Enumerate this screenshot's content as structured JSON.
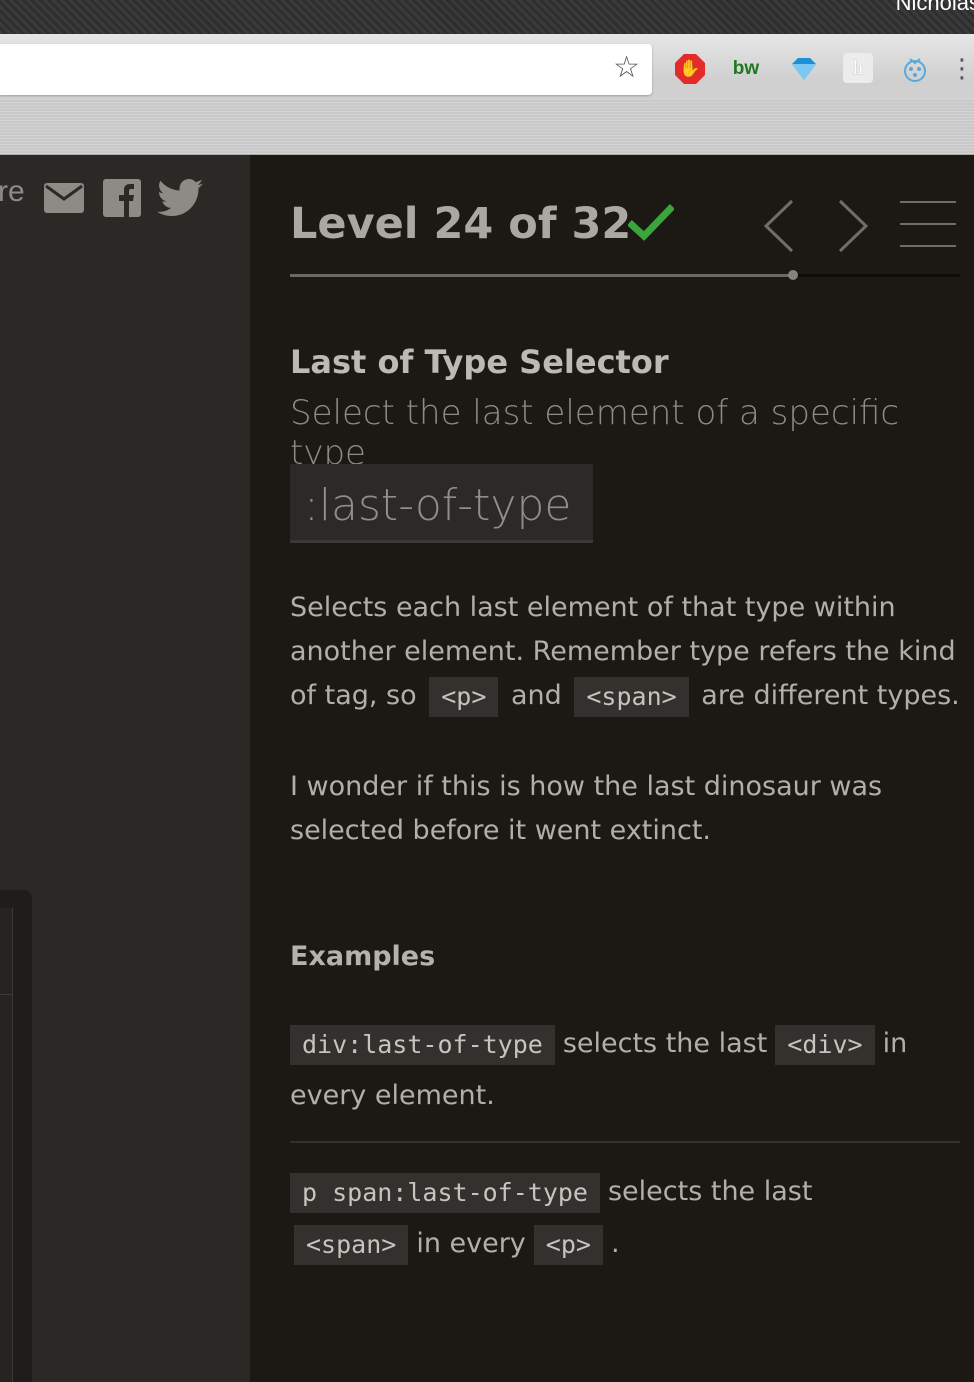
{
  "os": {
    "user_name": "Nicholas"
  },
  "extensions": [
    {
      "name": "adblock-icon"
    },
    {
      "name": "bw-icon",
      "label": "bw"
    },
    {
      "name": "gem-icon"
    },
    {
      "name": "h-icon",
      "label": "h"
    },
    {
      "name": "sparkle-icon"
    }
  ],
  "share": {
    "fragment": "re"
  },
  "level": {
    "text": "Level 24 of 32",
    "current": 24,
    "total": 32,
    "completed": true,
    "progress": 0.75
  },
  "selector": {
    "name": "Last of Type Selector",
    "subtitle": "Select the last element of a specific type",
    "syntax": ":last-of-type"
  },
  "description": {
    "line1": "Selects each last element of that type within",
    "line2": "another element. Remember type refers the kind",
    "line3_pre": "of tag, so",
    "tag_p": "<p>",
    "and": "and",
    "tag_span": "<span>",
    "line3_post": "are different types."
  },
  "note": {
    "line1": "I wonder if this is how the last dinosaur was",
    "line2": "selected before it went extinct."
  },
  "examples": {
    "heading": "Examples",
    "ex1": {
      "code": "div:last-of-type",
      "text1": "selects the last",
      "tag": "<div>",
      "text2": "in",
      "text3": "every element."
    },
    "ex2": {
      "code": "p span:last-of-type",
      "text1": "selects the last",
      "tag1": "<span>",
      "text2": "in every",
      "tag2": "<p>",
      "text3": "."
    }
  },
  "colors": {
    "check": "#3aa53a",
    "accent_progress": "#85837e"
  }
}
